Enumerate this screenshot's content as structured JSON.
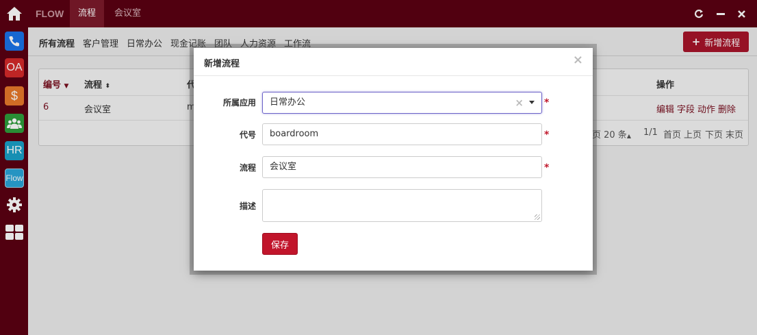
{
  "topbar": {
    "brand": "FLOW",
    "tabs": [
      {
        "label": "流程",
        "active": true
      },
      {
        "label": "会议室",
        "active": false
      }
    ],
    "controls": {
      "refresh": "C",
      "minimize": "—",
      "close": "✕"
    }
  },
  "sidebar": {
    "apps": [
      {
        "name": "phone",
        "label": "",
        "color": "#1a73e8"
      },
      {
        "name": "oa",
        "label": "OA",
        "color": "#d42a2a"
      },
      {
        "name": "finance",
        "label": "$",
        "color": "#e8792b"
      },
      {
        "name": "team",
        "label": "",
        "color": "#2e9e3b"
      },
      {
        "name": "hr",
        "label": "HR",
        "color": "#1aa0c8"
      },
      {
        "name": "flow",
        "label": "Flow",
        "color": "#2aa5d8"
      },
      {
        "name": "settings",
        "label": ""
      },
      {
        "name": "apps-grid",
        "label": ""
      }
    ]
  },
  "subnav": {
    "items": [
      "所有流程",
      "客户管理",
      "日常办公",
      "现金记账",
      "团队",
      "人力资源",
      "工作流"
    ],
    "add_button": "新增流程"
  },
  "table": {
    "headers": {
      "id": "编号",
      "flow": "流程",
      "code": "代",
      "actions": "操作"
    },
    "rows": [
      {
        "id": "6",
        "flow": "会议室",
        "code": "m"
      }
    ],
    "row_actions": [
      "编辑",
      "字段",
      "动作",
      "删除"
    ],
    "pager": {
      "per_page": "页 20 条",
      "pages": "1/1",
      "nav": [
        "首页",
        "上页",
        "下页",
        "末页"
      ]
    }
  },
  "modal": {
    "title": "新增流程",
    "close": "×",
    "fields": {
      "app_label": "所属应用",
      "app_value": "日常办公",
      "code_label": "代号",
      "code_value": "boardroom",
      "flow_label": "流程",
      "flow_value": "会议室",
      "desc_label": "描述"
    },
    "required_mark": "*",
    "save_button": "保存"
  }
}
